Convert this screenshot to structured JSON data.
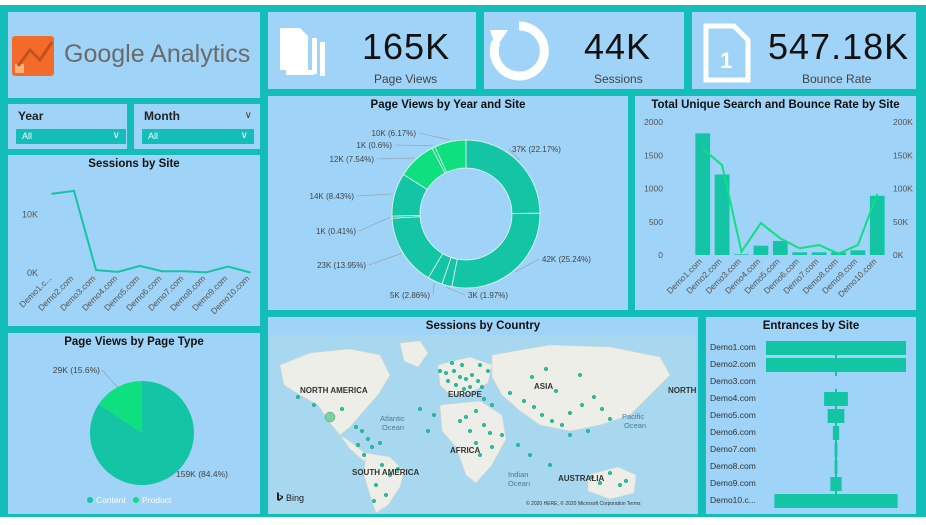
{
  "kpis": [
    {
      "value": "165K",
      "label": "Page Views",
      "icon": "document-stack-icon"
    },
    {
      "value": "44K",
      "label": "Sessions",
      "icon": "refresh-icon"
    },
    {
      "value": "547.18K",
      "label": "Bounce Rate",
      "icon": "page-one-icon"
    }
  ],
  "logo": {
    "text": "Google Analytics"
  },
  "slicers": {
    "year": {
      "label": "Year",
      "value": "All"
    },
    "month": {
      "label": "Month",
      "value": "All"
    }
  },
  "panels": {
    "sessions_by_site": "Sessions by Site",
    "page_views_year_site": "Page Views by Year and Site",
    "unique_search_bounce": "Total Unique Search and Bounce Rate by Site",
    "page_views_type": "Page Views by Page Type",
    "sessions_country": "Sessions by Country",
    "entrances_site": "Entrances by Site"
  },
  "map": {
    "labels": [
      "NORTH AMERICA",
      "EUROPE",
      "ASIA",
      "NORTH",
      "Atlantic",
      "Ocean",
      "Pacific",
      "Ocean",
      "AFRICA",
      "SOUTH AMERICA",
      "Indian",
      "Ocean",
      "AUSTRALIA"
    ],
    "bing": "Bing",
    "copyright": "© 2020 HERE, © 2020 Microsoft Corporation  Terms"
  },
  "chart_data": [
    {
      "type": "line",
      "title": "Sessions by Site",
      "categories": [
        "Demo1.c...",
        "Demo2.com",
        "Demo3.com",
        "Demo4.com",
        "Demo5.com",
        "Demo6.com",
        "Demo7.com",
        "Demo8.com",
        "Demo9.com",
        "Demo10.com"
      ],
      "values": [
        13500,
        14000,
        500,
        200,
        1200,
        300,
        300,
        100,
        1100,
        100
      ],
      "yticks": [
        "10K",
        "0K"
      ],
      "ylim": [
        0,
        15000
      ]
    },
    {
      "type": "pie",
      "title": "Page Views by Year and Site",
      "donut": true,
      "slices": [
        {
          "label": "37K (22.17%)",
          "value": 22.17,
          "color": "#13c5a4"
        },
        {
          "label": "42K (25.24%)",
          "value": 25.24,
          "color": "#13c5a4"
        },
        {
          "label": "3K (1.97%)",
          "value": 1.97,
          "color": "#13c5a4"
        },
        {
          "label": "5K (2.86%)",
          "value": 2.86,
          "color": "#13c5a4"
        },
        {
          "label": "23K (13.95%)",
          "value": 13.95,
          "color": "#13c5a4"
        },
        {
          "label": "1K (0.41%)",
          "value": 0.41,
          "color": "#13c5a4"
        },
        {
          "label": "14K (8.43%)",
          "value": 8.43,
          "color": "#13c5a4"
        },
        {
          "label": "12K (7.54%)",
          "value": 7.54,
          "color": "#0fe07f"
        },
        {
          "label": "1K (0.6%)",
          "value": 0.6,
          "color": "#0fe07f"
        },
        {
          "label": "10K (6.17%)",
          "value": 6.17,
          "color": "#0fe07f"
        }
      ]
    },
    {
      "type": "bar",
      "title": "Total Unique Search and Bounce Rate by Site",
      "categories": [
        "Demo1.com",
        "Demo2.com",
        "Demo3.com",
        "Demo4.com",
        "Demo5.com",
        "Demo6.com",
        "Demo7.com",
        "Demo8.com",
        "Demo9.com",
        "Demo10.com"
      ],
      "series": [
        {
          "values": [
            1830,
            1210,
            10,
            140,
            210,
            40,
            40,
            40,
            70,
            890
          ]
        },
        {
          "values": [
            160000,
            135000,
            5000,
            48000,
            25000,
            10000,
            15000,
            2000,
            15000,
            92000
          ]
        }
      ],
      "yticks_left": [
        "2000",
        "1500",
        "1000",
        "500",
        "0"
      ],
      "yticks_right": [
        "200K",
        "150K",
        "100K",
        "50K",
        "0K"
      ],
      "ylim_left": [
        0,
        2000
      ],
      "ylim_right": [
        0,
        200000
      ]
    },
    {
      "type": "pie",
      "title": "Page Views by Page Type",
      "slices": [
        {
          "label": "159K (84.4%)",
          "value": 84.4,
          "color": "#13c5a4",
          "name": "Content"
        },
        {
          "label": "29K (15.6%)",
          "value": 15.6,
          "color": "#0fe07f",
          "name": "Product"
        }
      ],
      "legend": [
        "Content",
        "Product"
      ]
    },
    {
      "type": "bar",
      "title": "Entrances by Site",
      "categories": [
        "Demo1.com",
        "Demo2.com",
        "Demo3.com",
        "Demo4.com",
        "Demo5.com",
        "Demo6.com",
        "Demo7.com",
        "Demo8.com",
        "Demo9.com",
        "Demo10.c..."
      ],
      "values": [
        1000,
        1000,
        0,
        170,
        120,
        45,
        20,
        20,
        80,
        880
      ]
    }
  ]
}
